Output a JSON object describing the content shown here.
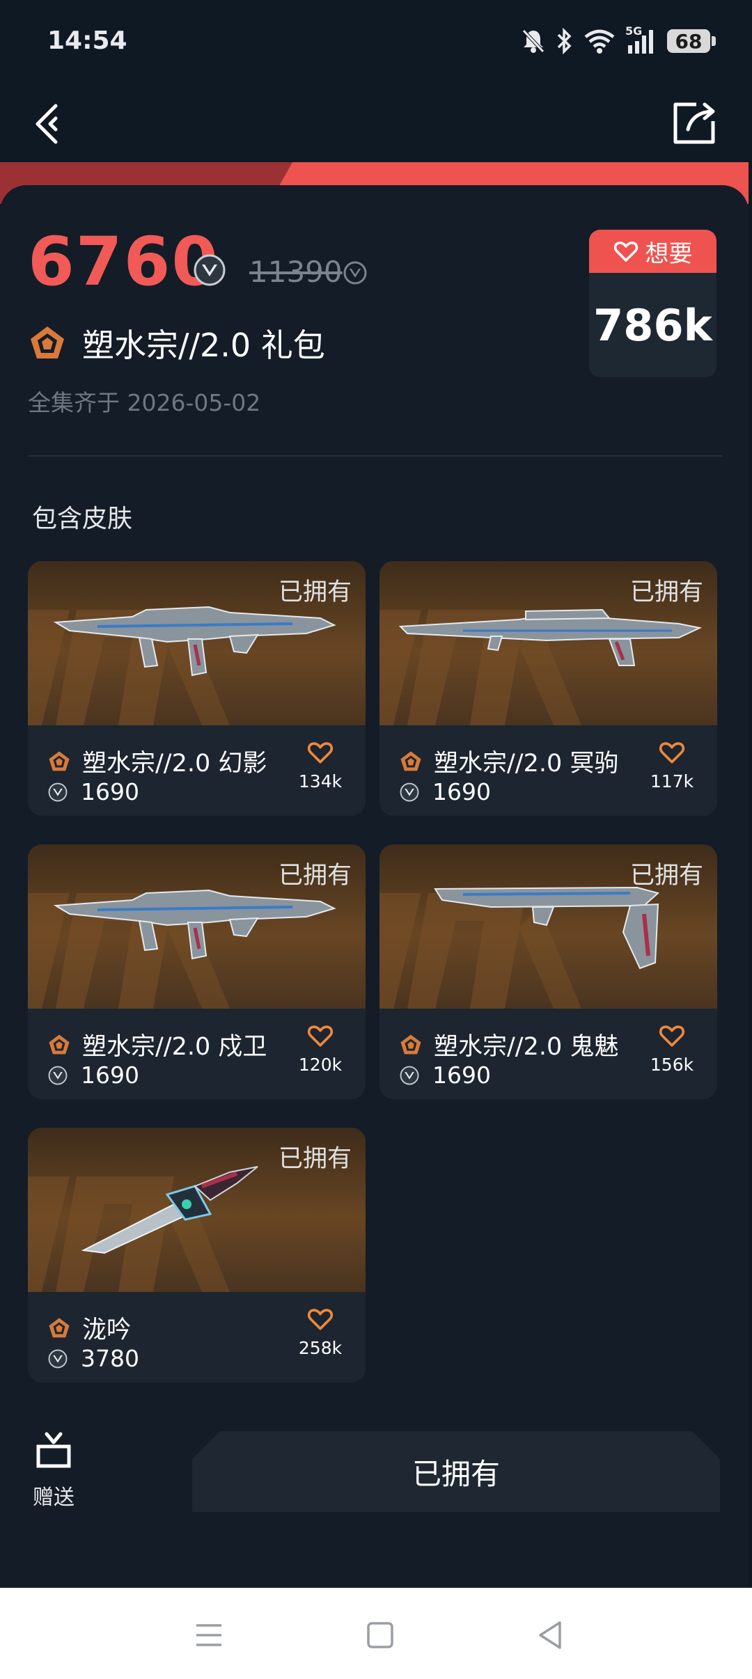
{
  "status_bar": {
    "time": "14:54",
    "battery": "68",
    "network": "5G"
  },
  "bundle": {
    "price": "6760",
    "original_price": "11390",
    "name": "塑水宗//2.0 礼包",
    "collected": "全集齐于 2026-05-02",
    "want_label": "想要",
    "want_count": "786k"
  },
  "section_title": "包含皮肤",
  "skins": [
    {
      "name": "塑水宗//2.0 幻影",
      "price": "1690",
      "likes": "134k",
      "status": "已拥有",
      "icon": "rifle-image"
    },
    {
      "name": "塑水宗//2.0 冥驹",
      "price": "1690",
      "likes": "117k",
      "status": "已拥有",
      "icon": "sniper-image"
    },
    {
      "name": "塑水宗//2.0 戍卫",
      "price": "1690",
      "likes": "120k",
      "status": "已拥有",
      "icon": "rifle-image"
    },
    {
      "name": "塑水宗//2.0 鬼魅",
      "price": "1690",
      "likes": "156k",
      "status": "已拥有",
      "icon": "pistol-image"
    },
    {
      "name": "泷吟",
      "price": "3780",
      "likes": "258k",
      "status": "已拥有",
      "icon": "knife-image"
    }
  ],
  "bottom": {
    "gift_label": "赠送",
    "owned_button": "已拥有"
  },
  "colors": {
    "accent": "#f15a56",
    "background": "#0f1923",
    "card": "#1c2530",
    "heart": "#f0883a"
  }
}
